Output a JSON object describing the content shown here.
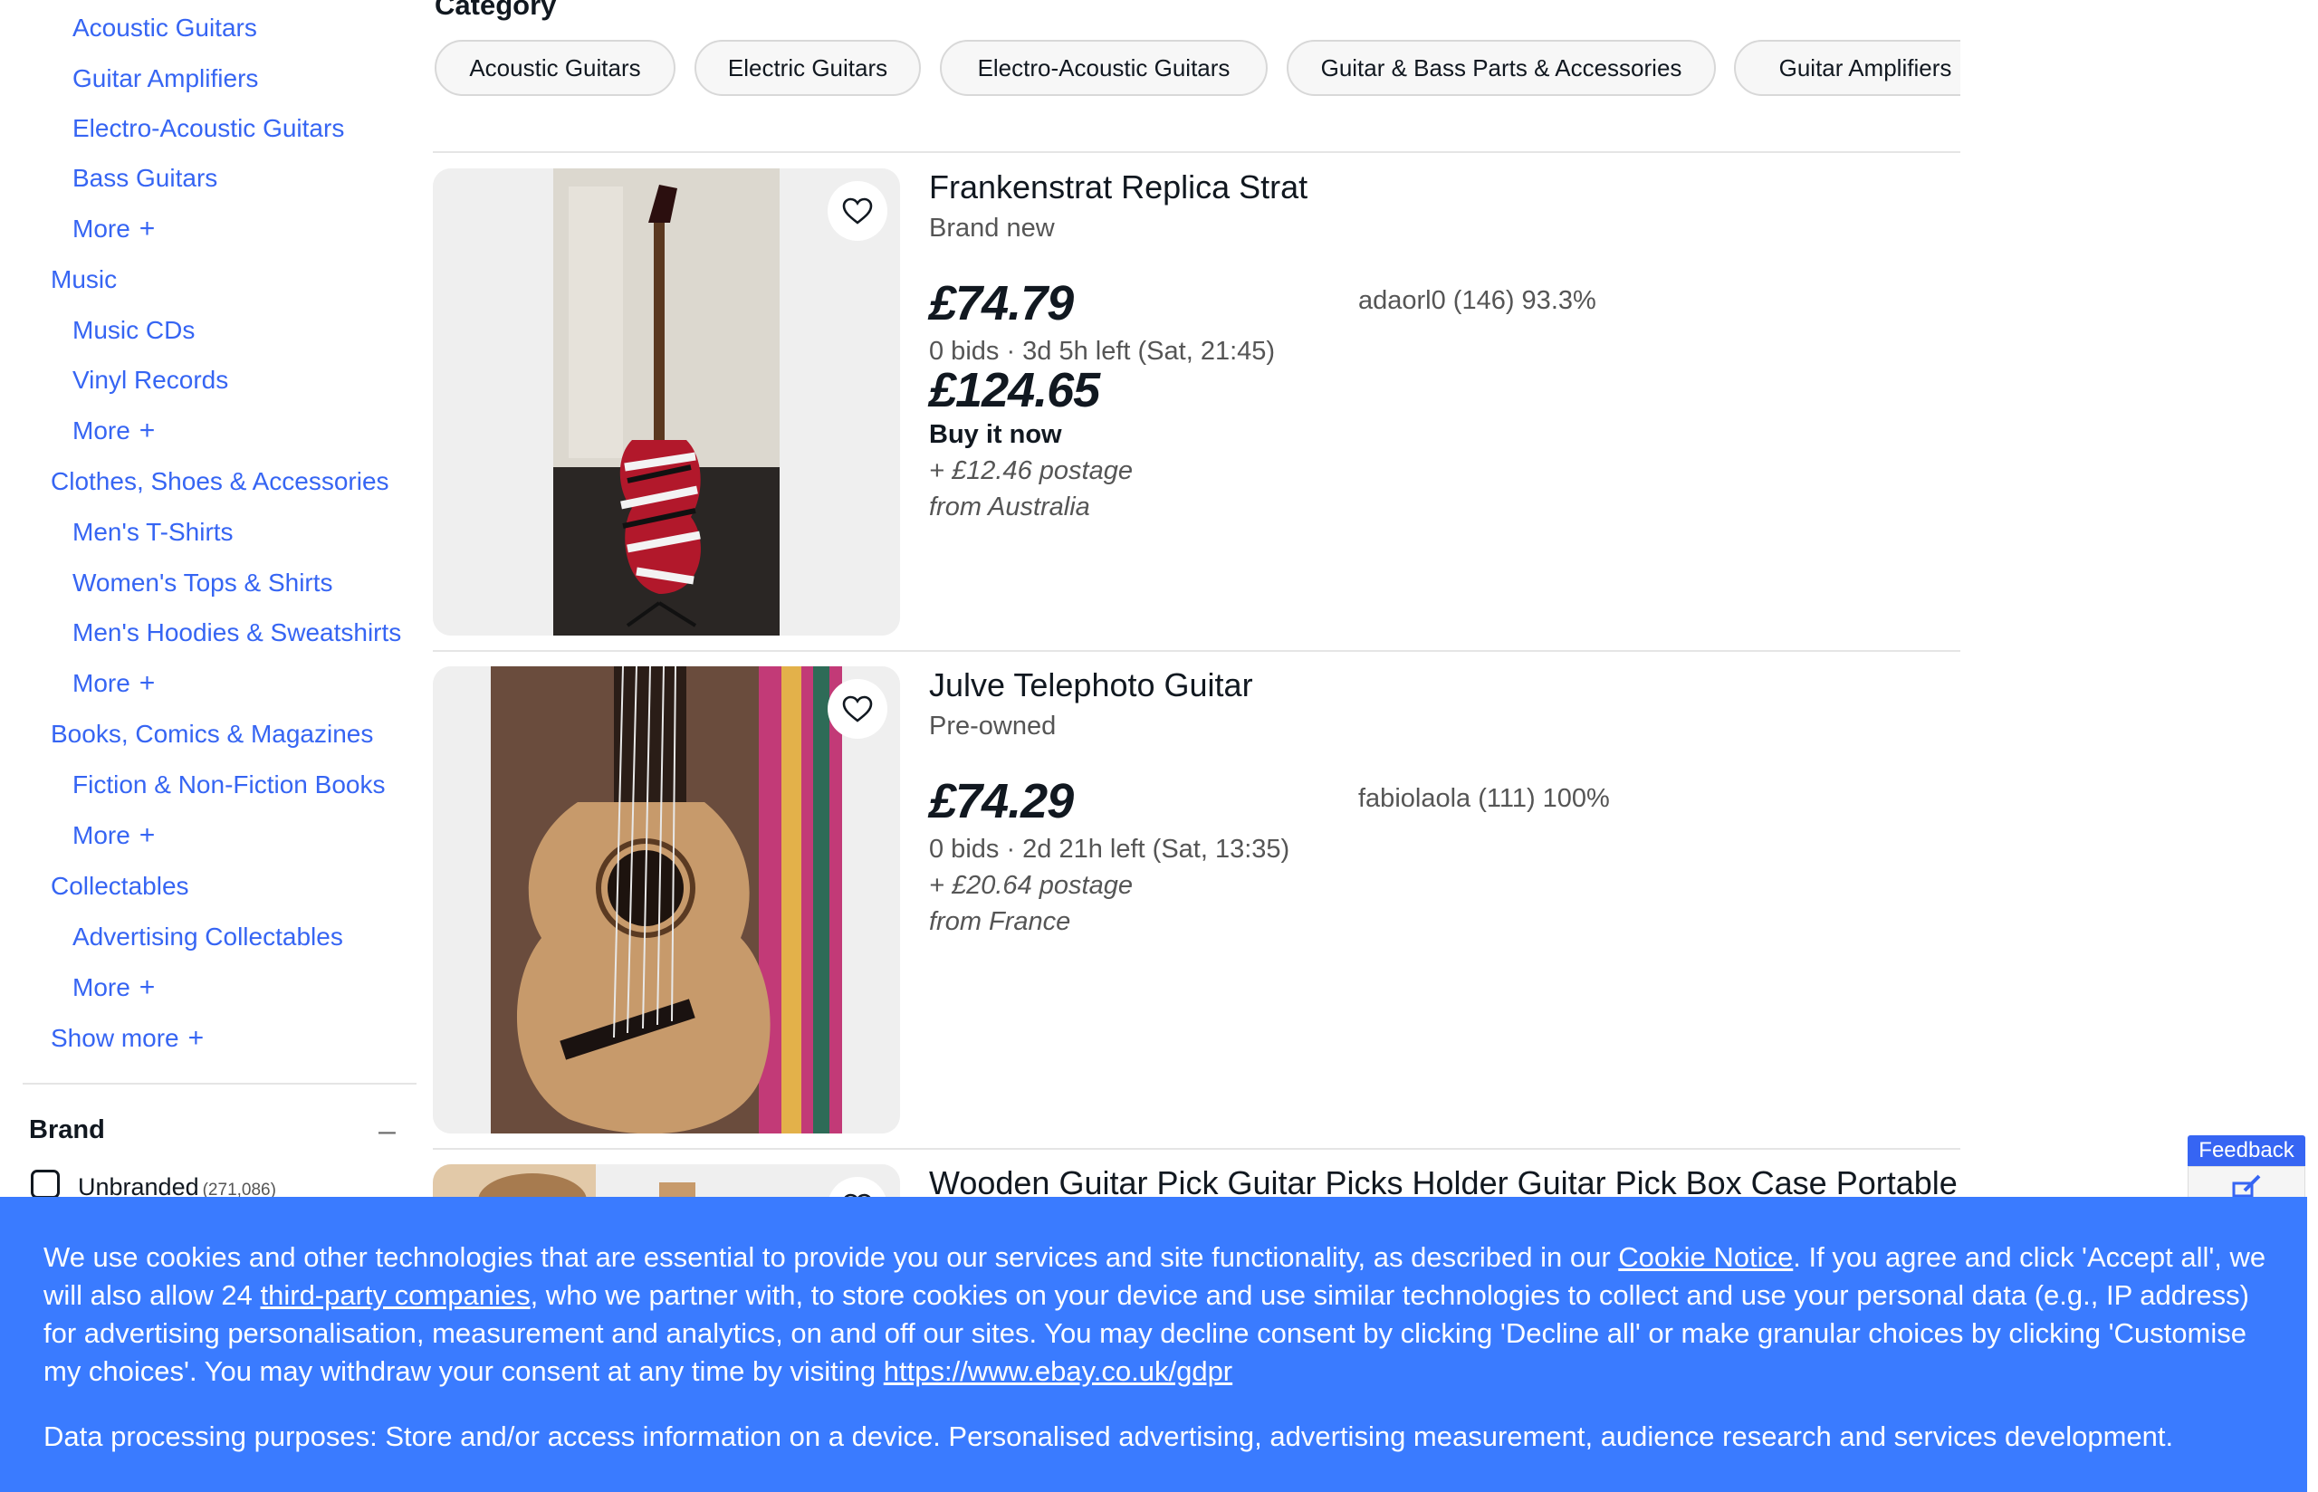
{
  "sidebar": {
    "items": [
      {
        "label": "Acoustic Guitars",
        "level": 2
      },
      {
        "label": "Guitar Amplifiers",
        "level": 2
      },
      {
        "label": "Electro-Acoustic Guitars",
        "level": 2
      },
      {
        "label": "Bass Guitars",
        "level": 2
      },
      {
        "label": "More",
        "level": 2,
        "more": true
      },
      {
        "label": "Music",
        "level": 1
      },
      {
        "label": "Music CDs",
        "level": 2
      },
      {
        "label": "Vinyl Records",
        "level": 2
      },
      {
        "label": "More",
        "level": 2,
        "more": true
      },
      {
        "label": "Clothes, Shoes & Accessories",
        "level": 1
      },
      {
        "label": "Men's T-Shirts",
        "level": 2
      },
      {
        "label": "Women's Tops & Shirts",
        "level": 2
      },
      {
        "label": "Men's Hoodies & Sweatshirts",
        "level": 2
      },
      {
        "label": "More",
        "level": 2,
        "more": true
      },
      {
        "label": "Books, Comics & Magazines",
        "level": 1
      },
      {
        "label": "Fiction & Non-Fiction Books",
        "level": 2
      },
      {
        "label": "More",
        "level": 2,
        "more": true
      },
      {
        "label": "Collectables",
        "level": 1
      },
      {
        "label": "Advertising Collectables",
        "level": 2
      },
      {
        "label": "More",
        "level": 2,
        "more": true
      },
      {
        "label": "Show more",
        "level": 1,
        "more": true
      }
    ],
    "plus_glyph": "+",
    "brand": {
      "heading": "Brand",
      "collapse_glyph": "–",
      "option_label": "Unbranded",
      "option_count": "(271,086)"
    }
  },
  "category": {
    "heading": "Category",
    "chips": [
      "Acoustic Guitars",
      "Electric Guitars",
      "Electro-Acoustic Guitars",
      "Guitar & Bass Parts & Accessories",
      "Guitar Amplifiers"
    ]
  },
  "listings": [
    {
      "title": "Frankenstrat Replica Strat",
      "condition": "Brand new",
      "price": "£74.79",
      "bids": "0 bids · 3d 5h left (Sat, 21:45)",
      "bin_price": "£124.65",
      "bin_label": "Buy it now",
      "postage": "+ £12.46 postage",
      "origin": "from Australia",
      "seller": "adaorl0 (146) 93.3%"
    },
    {
      "title": "Julve Telephoto Guitar",
      "condition": "Pre-owned",
      "price": "£74.29",
      "bids": "0 bids · 2d 21h left (Sat, 13:35)",
      "postage": "+ £20.64 postage",
      "origin": "from France",
      "seller": "fabiolaola (111) 100%"
    },
    {
      "title": "Wooden Guitar Pick Guitar Picks Holder Guitar Pick Box Case Portable"
    }
  ],
  "feedback": {
    "label": "Feedback"
  },
  "cookie": {
    "text_1": "We use cookies and other technologies that are essential to provide you our services and site functionality, as described in our ",
    "link_1": "Cookie Notice",
    "text_2": ". If you agree and click 'Accept all', we will also allow 24 ",
    "link_2": "third-party companies",
    "text_3": ", who we partner with, to store cookies on your device and use similar technologies to collect and use your personal data (e.g., IP address) for advertising personalisation, measurement and analytics, on and off our sites. You may decline consent by clicking 'Decline all' or make granular choices by clicking 'Customise my choices'. You may withdraw your consent at any time by visiting ",
    "link_3": "https://www.ebay.co.uk/gdpr",
    "purposes": "Data processing purposes: Store and/or access information on a device. Personalised advertising, advertising measurement, audience research and services development."
  },
  "colors": {
    "link": "#3665f3",
    "banner": "#3a7bff",
    "text": "#111820",
    "muted": "#555555"
  },
  "icons": [
    "heart-icon",
    "plus-icon",
    "minus-icon",
    "feedback-icon"
  ]
}
